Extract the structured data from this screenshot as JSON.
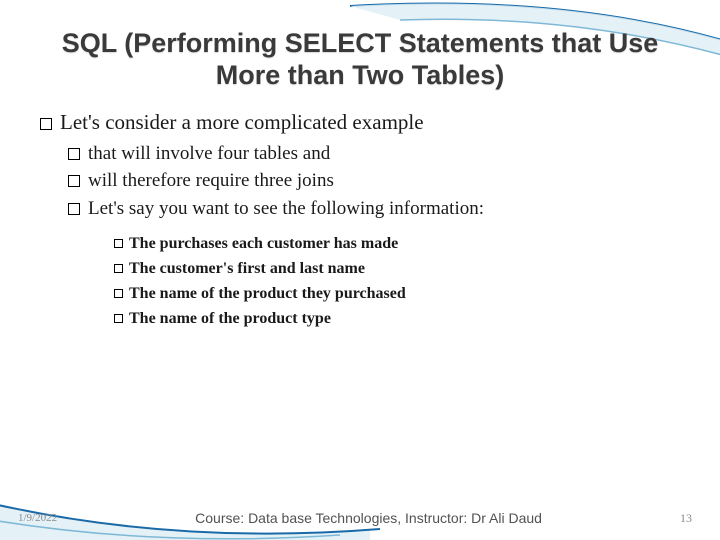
{
  "title": "SQL (Performing SELECT Statements that Use More than Two Tables)",
  "level1": {
    "item0": "Let's consider a more complicated example"
  },
  "level2": {
    "item0": "that will involve four tables and",
    "item1": "will therefore require three joins",
    "item2": "Let's say you want to see the following information:"
  },
  "level3": {
    "item0": "The purchases each customer has made",
    "item1": "The customer's first and last name",
    "item2": "The name of the product they purchased",
    "item3": "The name of the product type"
  },
  "footer": {
    "date": "1/9/2022",
    "course": "Course: Data base Technologies, Instructor: Dr Ali Daud",
    "page": "13"
  }
}
